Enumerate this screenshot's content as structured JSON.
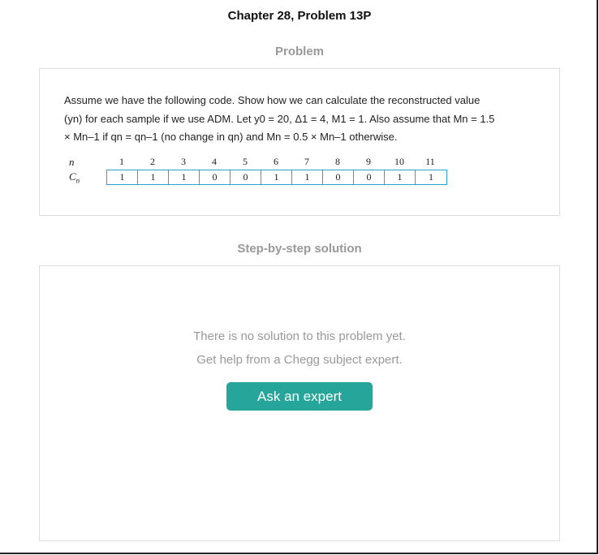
{
  "page": {
    "chapter_title": "Chapter 28, Problem 13P"
  },
  "problem": {
    "heading": "Problem",
    "text_line1": "Assume we have the following code. Show how we can calculate the reconstructed value",
    "text_line2": "(yn) for each sample if we use ADM. Let y0 = 20, Δ1 = 4, M1 = 1. Also assume that Mn = 1.5",
    "text_line3": "× Mn–1 if qn = qn–1 (no change in qn) and Mn = 0.5 × Mn–1 otherwise.",
    "table": {
      "n_label": "n",
      "c_label_main": "C",
      "c_label_sub": "n",
      "n_values": [
        "1",
        "2",
        "3",
        "4",
        "5",
        "6",
        "7",
        "8",
        "9",
        "10",
        "11"
      ],
      "c_values": [
        "1",
        "1",
        "1",
        "0",
        "0",
        "1",
        "1",
        "0",
        "0",
        "1",
        "1"
      ]
    }
  },
  "solution": {
    "heading": "Step-by-step solution",
    "message_line1": "There is no solution to this problem yet.",
    "message_line2": "Get help from a Chegg subject expert.",
    "button_label": "Ask an expert"
  },
  "colors": {
    "button": "#26a69a",
    "table_border": "#2aa0d8"
  }
}
